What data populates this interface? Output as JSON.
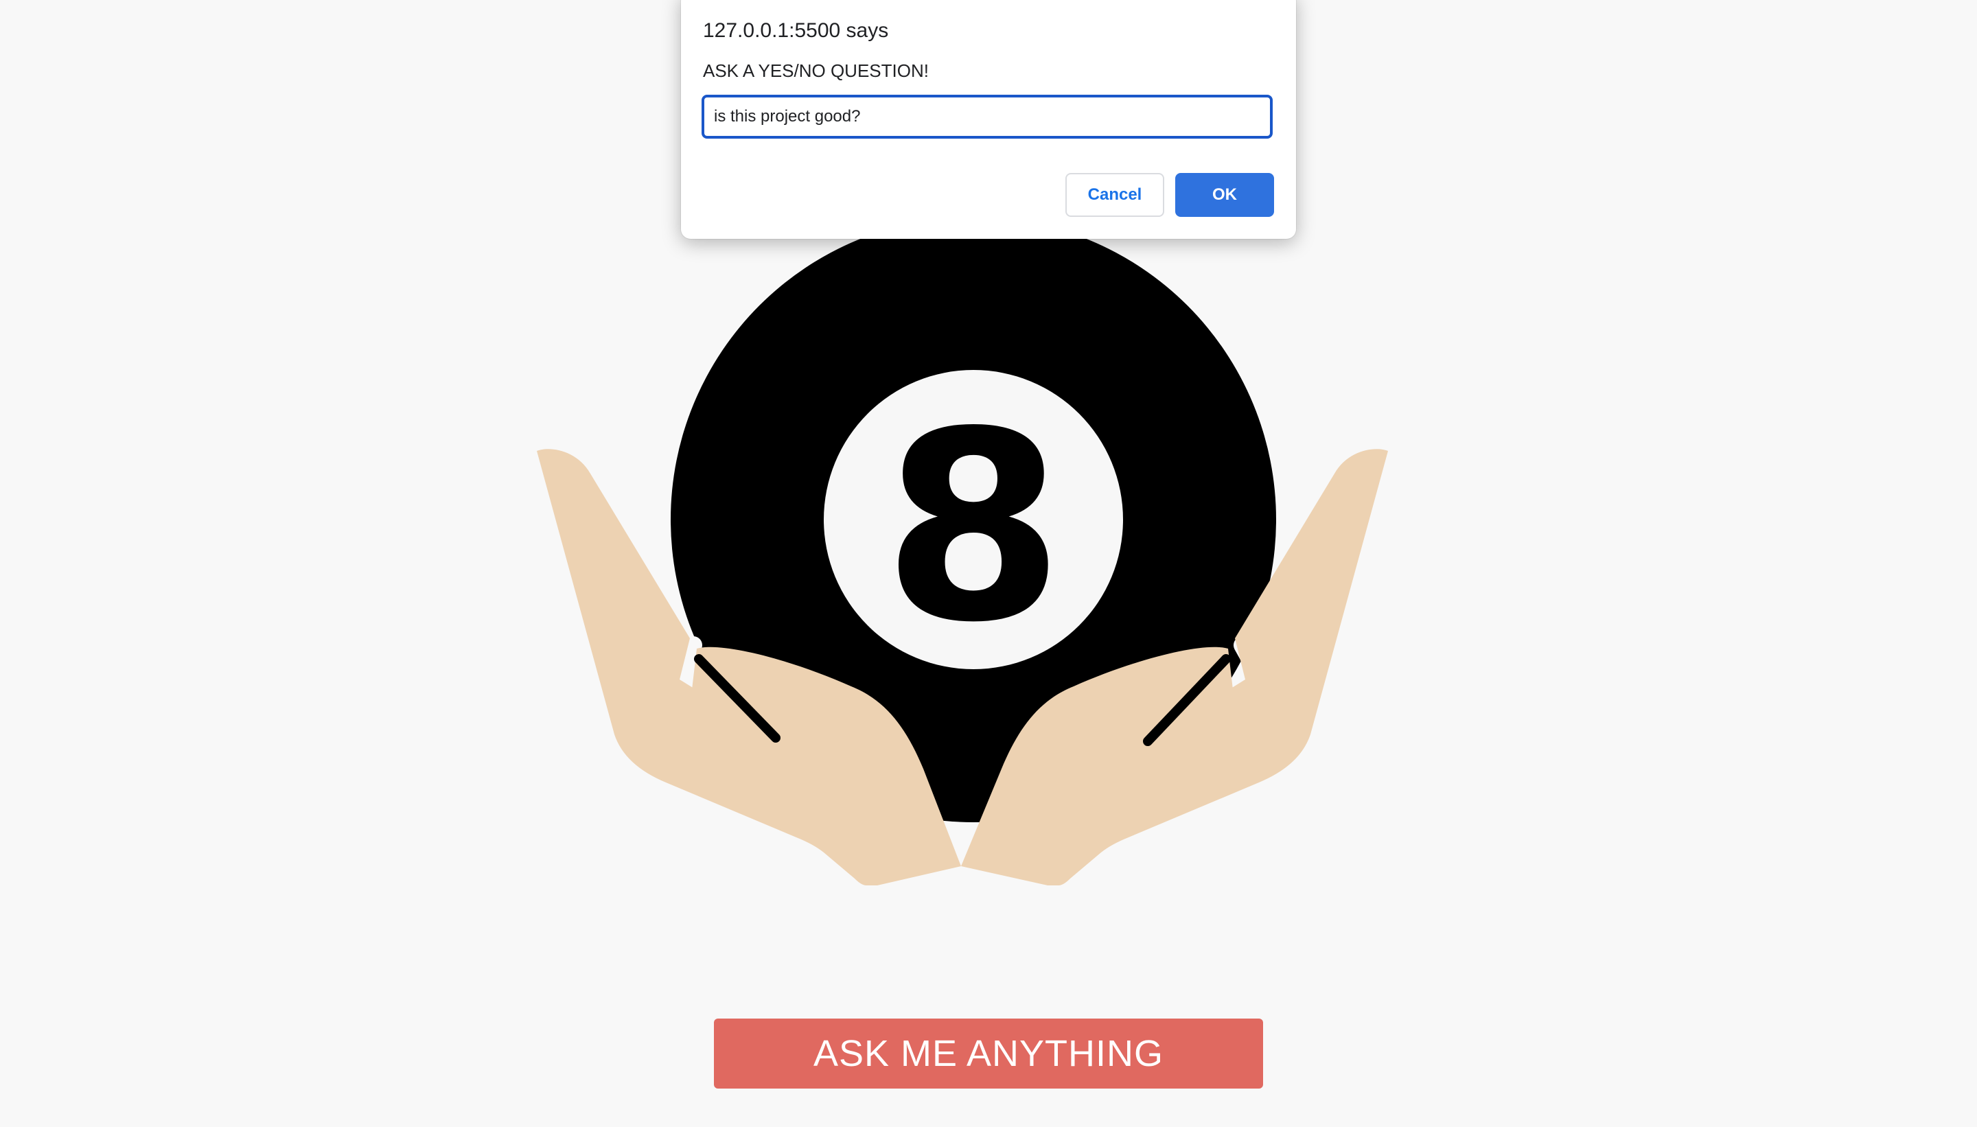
{
  "app": {
    "ask_button_label": "ASK ME ANYTHING",
    "ball_number": "8",
    "colors": {
      "background": "#f8f8f8",
      "ball": "#000000",
      "ball_window": "#f7f7f7",
      "hands": "#edd2b2",
      "button": "#e06960"
    }
  },
  "dialog": {
    "origin_text": "127.0.0.1:5500 says",
    "message": "ASK A YES/NO QUESTION!",
    "input_value": "is this project good?",
    "cancel_label": "Cancel",
    "ok_label": "OK",
    "colors": {
      "ok_background": "#2f72de",
      "input_focus_border": "#1a57c9"
    }
  }
}
